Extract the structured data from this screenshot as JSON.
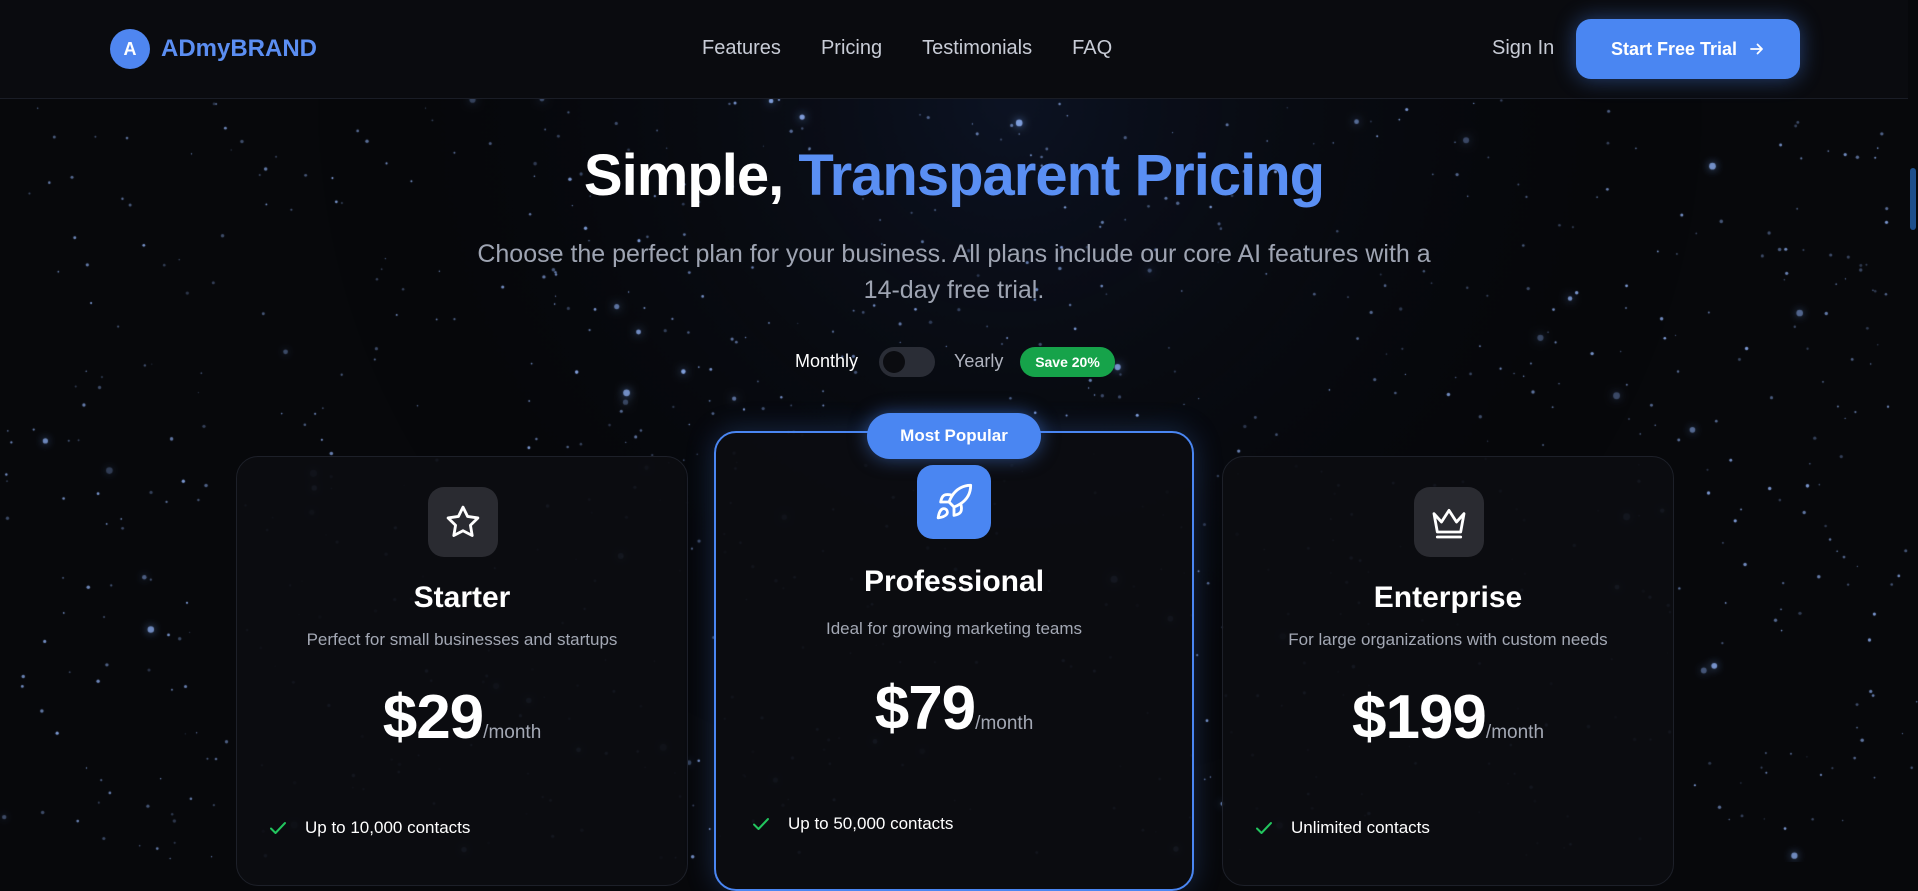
{
  "brand": {
    "logo_letter": "A",
    "name": "ADmyBRAND"
  },
  "nav": {
    "links": [
      "Features",
      "Pricing",
      "Testimonials",
      "FAQ"
    ],
    "sign_in": "Sign In",
    "cta": "Start Free Trial"
  },
  "hero": {
    "title_plain": "Simple,",
    "title_accent": "Transparent Pricing",
    "subtitle": "Choose the perfect plan for your business. All plans include our core AI features with a 14-day free trial."
  },
  "billing": {
    "monthly_label": "Monthly",
    "yearly_label": "Yearly",
    "save_badge": "Save 20%",
    "yearly_selected": false
  },
  "plans": [
    {
      "name": "Starter",
      "icon": "star-icon",
      "description": "Perfect for small businesses and startups",
      "price": "$29",
      "period": "/month",
      "features": [
        "Up to 10,000 contacts"
      ]
    },
    {
      "name": "Professional",
      "icon": "rocket-icon",
      "badge": "Most Popular",
      "description": "Ideal for growing marketing teams",
      "price": "$79",
      "period": "/month",
      "features": [
        "Up to 50,000 contacts"
      ]
    },
    {
      "name": "Enterprise",
      "icon": "crown-icon",
      "description": "For large organizations with custom needs",
      "price": "$199",
      "period": "/month",
      "features": [
        "Unlimited contacts"
      ]
    }
  ],
  "colors": {
    "accent": "#4a86f2",
    "background": "#07080b",
    "save_green": "#16a34a",
    "check_green": "#22c55e"
  }
}
